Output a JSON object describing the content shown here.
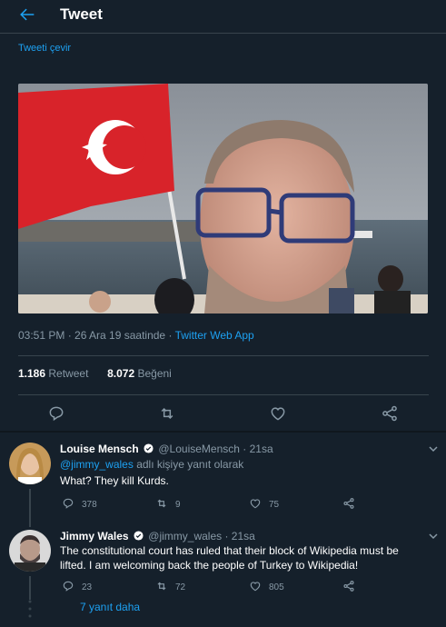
{
  "header": {
    "title": "Tweet",
    "back_icon": "arrow-left-icon"
  },
  "tweet": {
    "translate_label": "Tweeti çevir",
    "timestamp": "03:51 PM · 26 Ara 19 saatinde · ",
    "source": "Twitter Web App",
    "retweet_count": "1.186",
    "retweet_label": "Retweet",
    "like_count": "8.072",
    "like_label": "Beğeni"
  },
  "replies": [
    {
      "name": "Louise Mensch",
      "handle": "@LouiseMensch · 21sa",
      "replying_mention": "@jimmy_wales",
      "replying_text": " adlı kişiye yanıt olarak",
      "text": "What? They kill Kurds.",
      "reply_count": "378",
      "retweet_count": "9",
      "like_count": "75"
    },
    {
      "name": "Jimmy Wales",
      "handle": "@jimmy_wales · 21sa",
      "text": "The constitutional court has ruled that their block of Wikipedia must be lifted.  I am welcoming back the people of Turkey to Wikipedia!",
      "reply_count": "23",
      "retweet_count": "72",
      "like_count": "805"
    }
  ],
  "more_replies_label": "7 yanıt daha",
  "colors": {
    "background": "#15202b",
    "accent": "#1da1f2",
    "muted": "#8899a6",
    "border": "#38444d"
  }
}
